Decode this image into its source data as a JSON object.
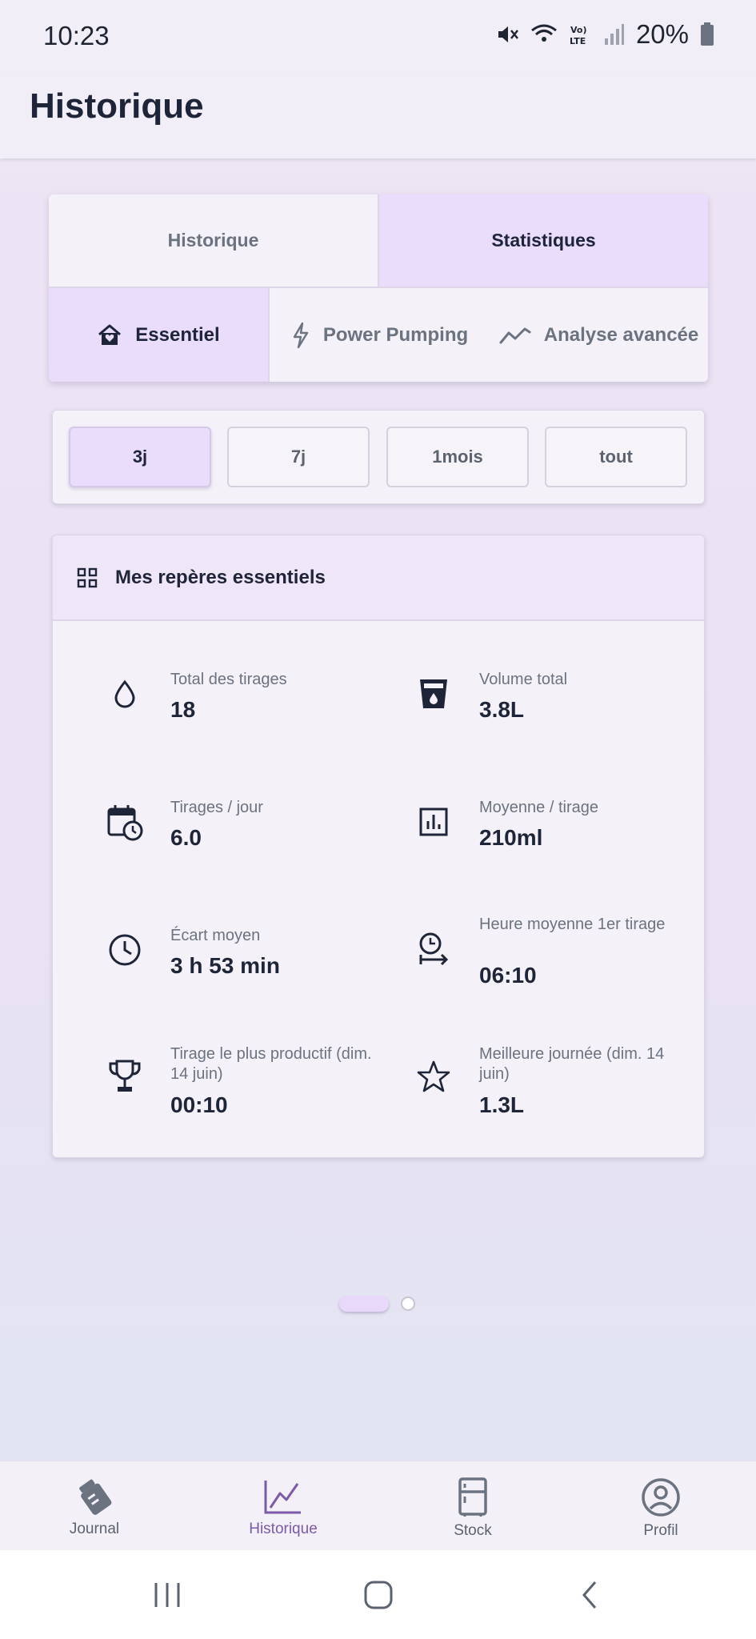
{
  "status": {
    "time": "10:23",
    "battery": "20%"
  },
  "app": {
    "title": "Historique"
  },
  "tabs": {
    "history": "Historique",
    "stats": "Statistiques"
  },
  "subtabs": {
    "essential": "Essentiel",
    "power": "Power Pumping",
    "advanced": "Analyse avancée"
  },
  "ranges": [
    "3j",
    "7j",
    "1mois",
    "tout"
  ],
  "section": {
    "title": "Mes repères essentiels"
  },
  "stats": [
    {
      "label": "Total des tirages",
      "value": "18",
      "icon": "drop-icon"
    },
    {
      "label": "Volume total",
      "value": "3.8L",
      "icon": "cup-icon"
    },
    {
      "label": "Tirages / jour",
      "value": "6.0",
      "icon": "calendar-clock-icon"
    },
    {
      "label": "Moyenne / tirage",
      "value": "210ml",
      "icon": "bar-chart-icon"
    },
    {
      "label": "Écart moyen",
      "value": "3 h 53 min",
      "icon": "clock-icon"
    },
    {
      "label": "Heure moyenne 1er tirage",
      "value": "06:10",
      "icon": "alarm-arrow-icon"
    },
    {
      "label": "Tirage le plus productif (dim. 14 juin)",
      "value": "00:10",
      "icon": "trophy-icon"
    },
    {
      "label": "Meilleure journée (dim. 14 juin)",
      "value": "1.3L",
      "icon": "star-icon"
    }
  ],
  "nav": {
    "journal": "Journal",
    "history": "Historique",
    "stock": "Stock",
    "profile": "Profil"
  },
  "colors": {
    "accent": "#eadcfb",
    "active_nav": "#7c5aa8",
    "text": "#1f2538"
  }
}
